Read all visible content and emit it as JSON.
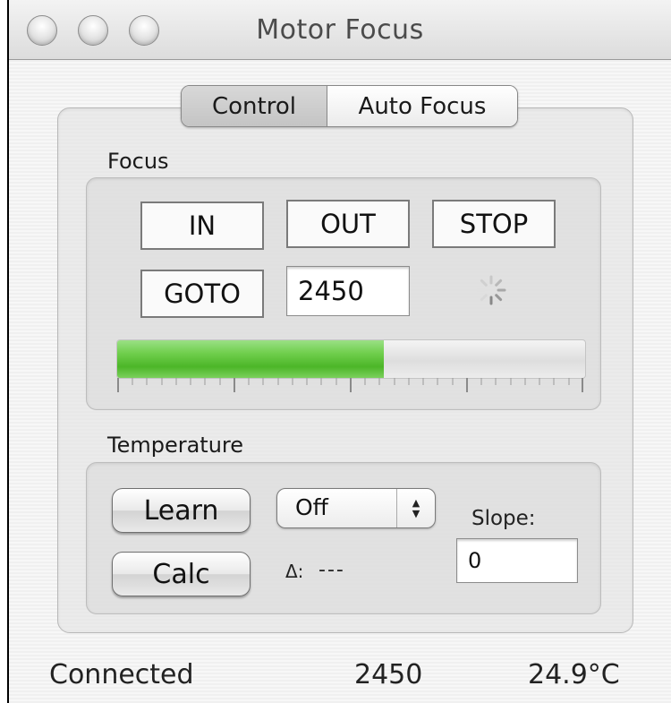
{
  "window": {
    "title": "Motor Focus",
    "traffic_lights": [
      "close",
      "minimize",
      "zoom"
    ]
  },
  "tabs": [
    {
      "label": "Control",
      "selected": true
    },
    {
      "label": "Auto Focus",
      "selected": false
    }
  ],
  "focus": {
    "section_label": "Focus",
    "in_label": "IN",
    "out_label": "OUT",
    "stop_label": "STOP",
    "goto_label": "GOTO",
    "goto_value": "2450",
    "progress_fraction": 0.57,
    "spinner_icon": "progress-spinner-icon"
  },
  "temperature": {
    "section_label": "Temperature",
    "learn_label": "Learn",
    "calc_label": "Calc",
    "mode_value": "Off",
    "slope_label": "Slope:",
    "slope_value": "0",
    "delta_label": "Δ:",
    "delta_value": "---"
  },
  "status": {
    "connection": "Connected",
    "position": "2450",
    "temperature": "24.9°C"
  },
  "colors": {
    "progress_green": "#5cc03a",
    "window_border": "#000000"
  }
}
